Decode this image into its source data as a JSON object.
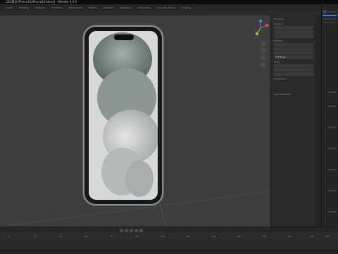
{
  "window": {
    "title": "…\\3D/模型/iPhone15/iPhone15.blend] - Blender 4.0.0"
  },
  "menu": {
    "items": [
      "Layout",
      "Modeling",
      "Sculpting",
      "UV Editing",
      "Texture Paint",
      "Shading",
      "Animation",
      "Rendering",
      "Compositing",
      "Geometry Nodes",
      "Scripting",
      "+"
    ]
  },
  "n_panel": {
    "section_transform": "Transform",
    "rows": [
      "Location",
      "Rotation",
      "Scale",
      "Dimensions"
    ],
    "mode_value": "XYZ Euler",
    "collapsed_section": "Delta Transform"
  },
  "timeline": {
    "ruler": [
      "0",
      "20",
      "40",
      "60",
      "80",
      "100",
      "120",
      "140",
      "160",
      "180",
      "200",
      "220",
      "240",
      "250"
    ]
  },
  "colors": {
    "accent_blue": "#3d80d9",
    "axis_x": "#e04a5f",
    "axis_y": "#85c44b",
    "axis_z": "#4a90e2",
    "origin_orange": "#d8892b"
  },
  "icons": [
    "blender-logo-icon",
    "play-icon",
    "pause-icon",
    "skip-start-icon",
    "skip-end-icon",
    "grid-icon",
    "hand-icon",
    "zoom-icon",
    "camera-icon"
  ]
}
